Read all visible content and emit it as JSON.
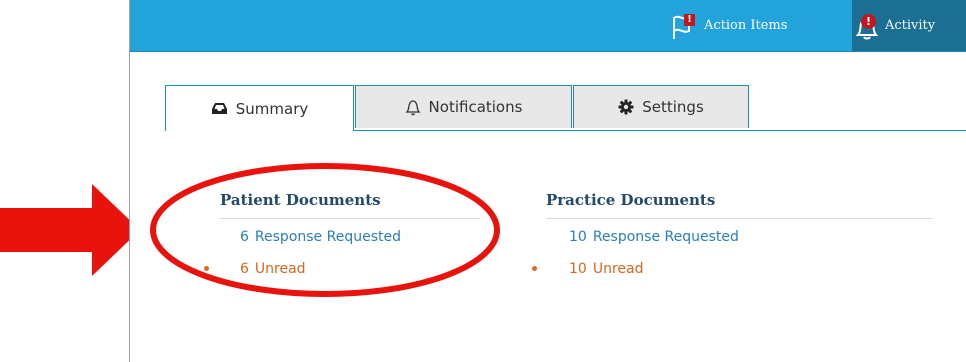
{
  "topbar": {
    "action_items": {
      "label": "Action Items",
      "icon": "flag-icon",
      "badge": "!"
    },
    "activity": {
      "label": "Activity",
      "icon": "bell-icon",
      "badge": "!"
    }
  },
  "tabs": [
    {
      "label": "Summary",
      "icon": "inbox-icon",
      "active": true
    },
    {
      "label": "Notifications",
      "icon": "bell-outline-icon",
      "active": false
    },
    {
      "label": "Settings",
      "icon": "gear-icon",
      "active": false
    }
  ],
  "documents": {
    "patient": {
      "heading": "Patient Documents",
      "requested": {
        "count": "6",
        "label": "Response Requested"
      },
      "unread": {
        "count": "6",
        "label": "Unread"
      }
    },
    "practice": {
      "heading": "Practice Documents",
      "requested": {
        "count": "10",
        "label": "Response Requested"
      },
      "unread": {
        "count": "10",
        "label": "Unread"
      }
    }
  },
  "colors": {
    "topbar": "#22a3dc",
    "activity_bg": "#1a6f93",
    "link_blue": "#2a7fb6",
    "unread_orange": "#d9661a",
    "heading_navy": "#234a6b",
    "annotation_red": "#e8130c"
  }
}
